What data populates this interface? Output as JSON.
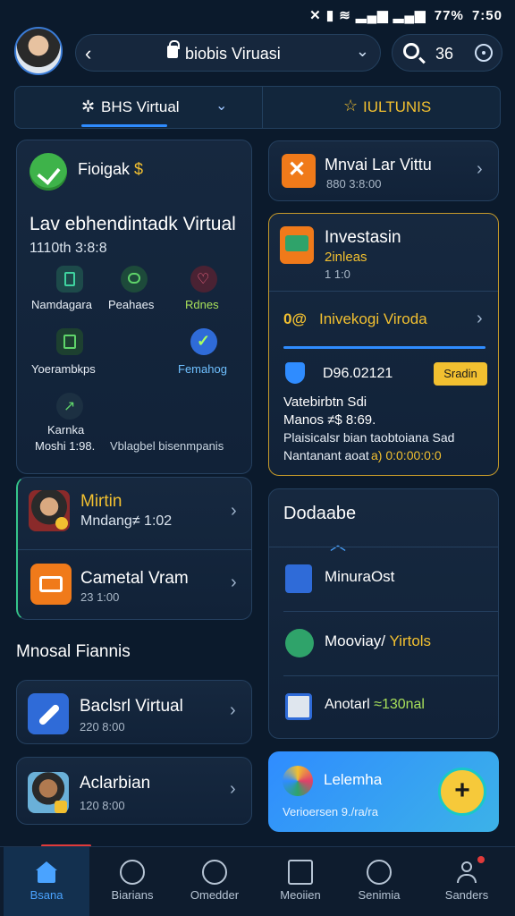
{
  "statusbar": {
    "icons_text": "✕ ▮ ≋ ▂▄▆ ▂▄▆",
    "battery": "77%",
    "time": "7:50"
  },
  "header": {
    "address_title": "biobis Viruasi",
    "search_count": "36"
  },
  "tabs": [
    {
      "label": "BHS Virtual",
      "active": true
    },
    {
      "label": "IULTUNIS",
      "active": false
    }
  ],
  "main_card": {
    "title": "Fioigak",
    "title_suffix": "$",
    "heading": "Lav ebhendintadk Virtual",
    "subheading": "1110th 3:8:8",
    "grid": [
      {
        "label": "Namdagara",
        "icon": "doc-icon"
      },
      {
        "label": "Peahaes",
        "icon": "chat-icon"
      },
      {
        "label": "Rdnes",
        "icon": "heart-icon"
      },
      {
        "label": "Yoerambkps",
        "icon": "calendar-icon"
      },
      {
        "label": "Femahog",
        "icon": "check-circle-icon"
      },
      {
        "label": "Karnka",
        "icon": "chart-icon"
      }
    ],
    "footer_left": "Moshi 1:98.",
    "footer_right": "Vblagbel bisenmpanis"
  },
  "right_cards": {
    "card1": {
      "title": "Mnvai Lar Vittu",
      "sub": "880 3:8:00"
    },
    "card2": {
      "title": "Investasin",
      "line1": "2inleas",
      "line2": "1 1:0",
      "link": "Inivekogi Viroda",
      "link_prefix": "0@",
      "date": "D96.02121",
      "badge": "Sradin",
      "desc1": "Vatebirbtn Sdi",
      "desc2": "Manos ≠$ 8:69.",
      "desc3": "Plaisicalsr bian taobtoiana Sad",
      "desc4_a": "Nantanant aoat",
      "desc4_b": "a) 0:0:00:0:0"
    },
    "card3": {
      "title": "Dodaabe",
      "items": [
        {
          "label": "MinuraOst",
          "icon": "document-icon"
        },
        {
          "label_a": "Mooviay/",
          "label_b": "Yirtols",
          "icon": "chat-bubble-icon"
        },
        {
          "label_a": "Anotarl",
          "label_b": "≈130nal",
          "icon": "spreadsheet-icon"
        }
      ]
    },
    "fab_card": {
      "title": "Lelemha",
      "sub": "Verioersen 9./ra/ra"
    }
  },
  "left_lower": {
    "item1": {
      "title": "Mirtin",
      "sub": "Mndang≠ 1:02"
    },
    "item2": {
      "title": "Cametal Vram",
      "sub": "23 1:00"
    },
    "section_title": "Mnosal Fiannis",
    "item3": {
      "title": "Baclsrl Virtual",
      "sub": "220 8:00"
    },
    "item4": {
      "title": "Aclarbian",
      "sub": "120 8:00"
    }
  },
  "bottom_nav": [
    {
      "label": "Bsana",
      "icon": "home-icon",
      "active": true
    },
    {
      "label": "Biarians",
      "icon": "gauge-icon",
      "active": false
    },
    {
      "label": "Omedder",
      "icon": "compass-icon",
      "active": false
    },
    {
      "label": "Meoiien",
      "icon": "list-icon",
      "active": false
    },
    {
      "label": "Senimia",
      "icon": "clock-icon",
      "active": false
    },
    {
      "label": "Sanders",
      "icon": "user-icon",
      "active": false
    }
  ],
  "colors": {
    "accent": "#2f8cff",
    "gold": "#f2c030",
    "bg": "#0b1a2c"
  }
}
